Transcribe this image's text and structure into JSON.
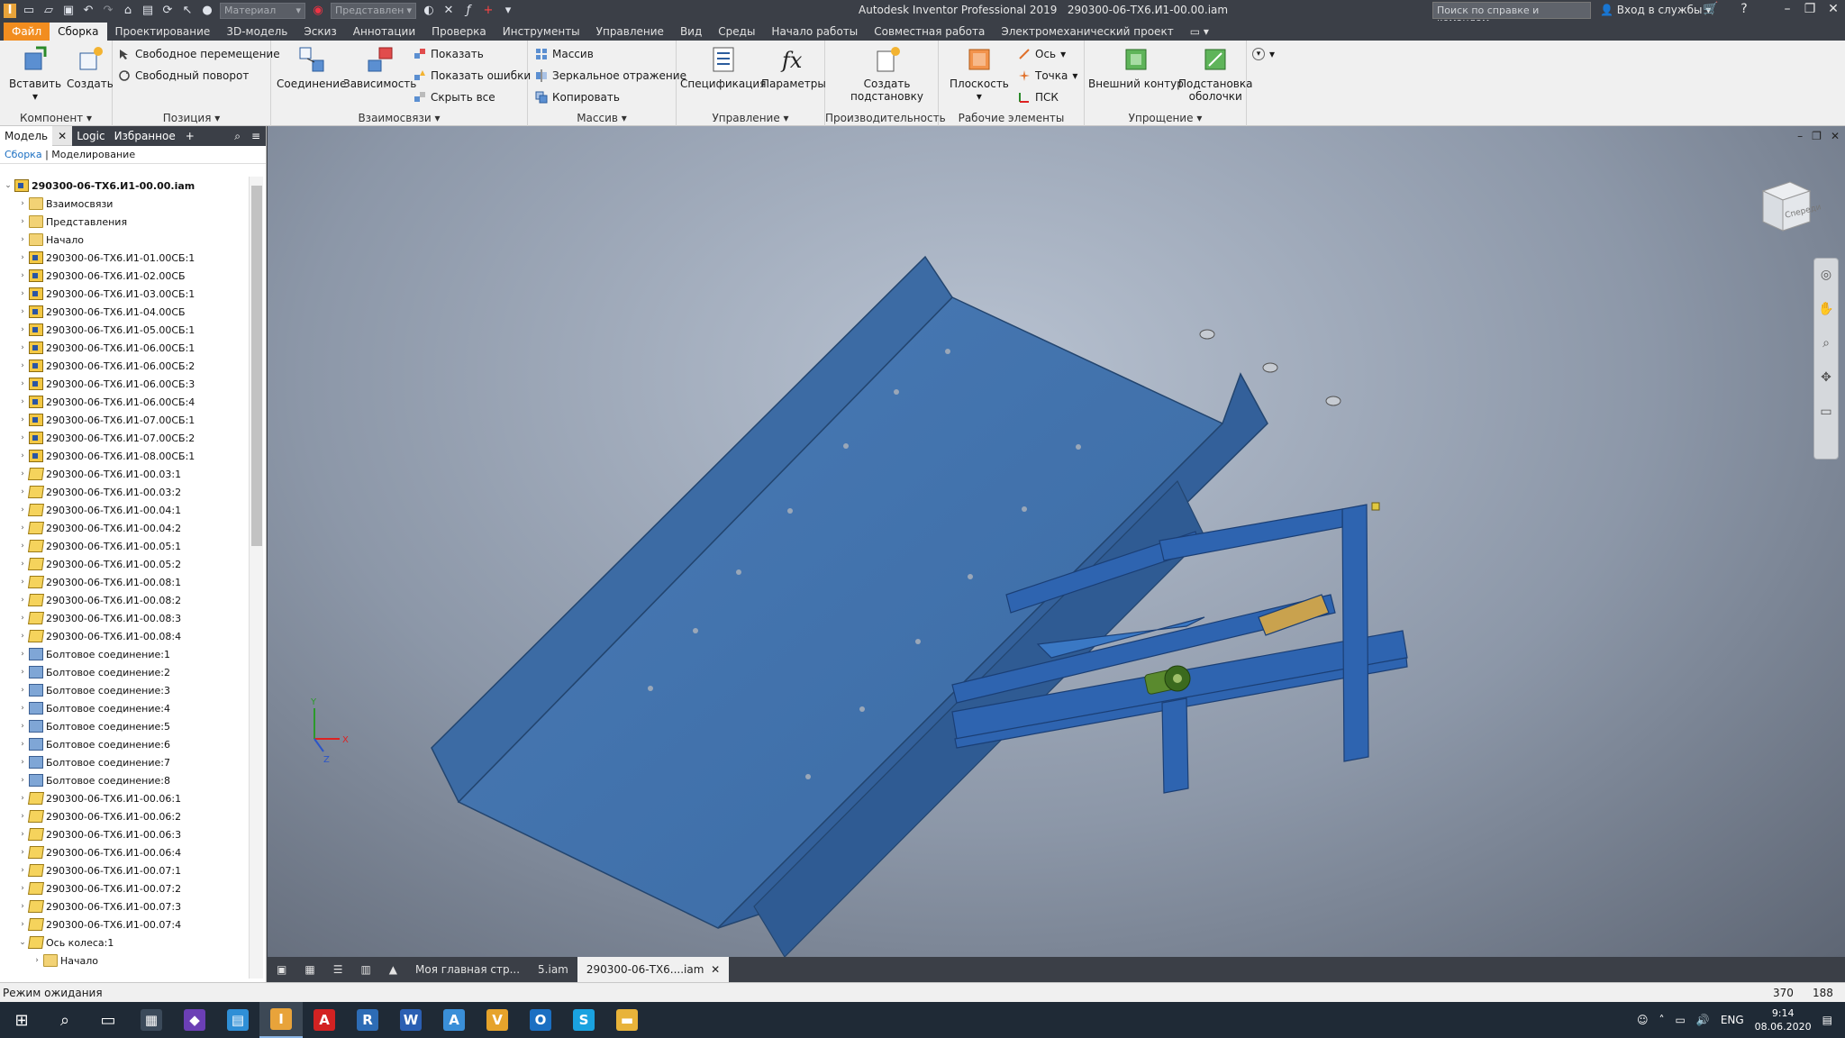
{
  "window": {
    "app_title": "Autodesk Inventor Professional 2019",
    "doc_title": "290300-06-ТХ6.И1-00.00.iam",
    "help_search_placeholder": "Поиск по справке и командам",
    "login_label": "Вход в службы",
    "material_dropdown": "Материал",
    "appearance_dropdown": "Представлен"
  },
  "ribbon_tabs": [
    "Файл",
    "Сборка",
    "Проектирование",
    "3D-модель",
    "Эскиз",
    "Аннотации",
    "Проверка",
    "Инструменты",
    "Управление",
    "Вид",
    "Среды",
    "Начало работы",
    "Совместная работа",
    "Электромеханический проект"
  ],
  "ribbon": {
    "component": {
      "title": "Компонент",
      "insert": "Вставить",
      "create": "Создать"
    },
    "position": {
      "title": "Позиция",
      "free_move": "Свободное перемещение",
      "free_rotate": "Свободный поворот"
    },
    "relationships": {
      "title": "Взаимосвязи",
      "joint": "Соединение",
      "constrain": "Зависимость",
      "show": "Показать",
      "show_errors": "Показать ошибки",
      "hide_all": "Скрыть все"
    },
    "pattern": {
      "title": "Массив",
      "pattern": "Массив",
      "mirror": "Зеркальное отражение",
      "copy": "Копировать"
    },
    "manage": {
      "title": "Управление",
      "bom": "Спецификация",
      "params": "Параметры"
    },
    "productivity": {
      "title": "Производительность",
      "substitute_line1": "Создать",
      "substitute_line2": "подстановку"
    },
    "work_features": {
      "title": "Рабочие элементы",
      "plane": "Плоскость",
      "axis": "Ось",
      "point": "Точка",
      "ucs": "ПСК"
    },
    "simplify": {
      "title": "Упрощение",
      "shrinkwrap": "Внешний контур",
      "substitute_line1": "Подстановка",
      "substitute_line2": "оболочки"
    }
  },
  "browser": {
    "tabs": [
      "Модель",
      "Logic",
      "Избранное"
    ],
    "crumb_root": "Сборка",
    "crumb_current": "Моделирование",
    "tree": [
      {
        "label": "290300-06-ТХ6.И1-00.00.iam",
        "icon": "asm",
        "level": 0,
        "expanded": true,
        "bold": true
      },
      {
        "label": "Взаимосвязи",
        "icon": "folder",
        "level": 1
      },
      {
        "label": "Представления",
        "icon": "folder",
        "level": 1
      },
      {
        "label": "Начало",
        "icon": "folder",
        "level": 1
      },
      {
        "label": "290300-06-ТХ6.И1-01.00СБ:1",
        "icon": "asm",
        "level": 1
      },
      {
        "label": "290300-06-ТХ6.И1-02.00СБ",
        "icon": "asm",
        "level": 1
      },
      {
        "label": "290300-06-ТХ6.И1-03.00СБ:1",
        "icon": "asm",
        "level": 1
      },
      {
        "label": "290300-06-ТХ6.И1-04.00СБ",
        "icon": "asm",
        "level": 1
      },
      {
        "label": "290300-06-ТХ6.И1-05.00СБ:1",
        "icon": "asm",
        "level": 1
      },
      {
        "label": "290300-06-ТХ6.И1-06.00СБ:1",
        "icon": "asm",
        "level": 1
      },
      {
        "label": "290300-06-ТХ6.И1-06.00СБ:2",
        "icon": "asm",
        "level": 1
      },
      {
        "label": "290300-06-ТХ6.И1-06.00СБ:3",
        "icon": "asm",
        "level": 1
      },
      {
        "label": "290300-06-ТХ6.И1-06.00СБ:4",
        "icon": "asm",
        "level": 1
      },
      {
        "label": "290300-06-ТХ6.И1-07.00СБ:1",
        "icon": "asm",
        "level": 1
      },
      {
        "label": "290300-06-ТХ6.И1-07.00СБ:2",
        "icon": "asm",
        "level": 1
      },
      {
        "label": "290300-06-ТХ6.И1-08.00СБ:1",
        "icon": "asm",
        "level": 1
      },
      {
        "label": "290300-06-ТХ6.И1-00.03:1",
        "icon": "part",
        "level": 1
      },
      {
        "label": "290300-06-ТХ6.И1-00.03:2",
        "icon": "part",
        "level": 1
      },
      {
        "label": "290300-06-ТХ6.И1-00.04:1",
        "icon": "part",
        "level": 1
      },
      {
        "label": "290300-06-ТХ6.И1-00.04:2",
        "icon": "part",
        "level": 1
      },
      {
        "label": "290300-06-ТХ6.И1-00.05:1",
        "icon": "part",
        "level": 1
      },
      {
        "label": "290300-06-ТХ6.И1-00.05:2",
        "icon": "part",
        "level": 1
      },
      {
        "label": "290300-06-ТХ6.И1-00.08:1",
        "icon": "part",
        "level": 1
      },
      {
        "label": "290300-06-ТХ6.И1-00.08:2",
        "icon": "part",
        "level": 1
      },
      {
        "label": "290300-06-ТХ6.И1-00.08:3",
        "icon": "part",
        "level": 1
      },
      {
        "label": "290300-06-ТХ6.И1-00.08:4",
        "icon": "part",
        "level": 1
      },
      {
        "label": "Болтовое соединение:1",
        "icon": "bolt",
        "level": 1
      },
      {
        "label": "Болтовое соединение:2",
        "icon": "bolt",
        "level": 1
      },
      {
        "label": "Болтовое соединение:3",
        "icon": "bolt",
        "level": 1
      },
      {
        "label": "Болтовое соединение:4",
        "icon": "bolt",
        "level": 1
      },
      {
        "label": "Болтовое соединение:5",
        "icon": "bolt",
        "level": 1
      },
      {
        "label": "Болтовое соединение:6",
        "icon": "bolt",
        "level": 1
      },
      {
        "label": "Болтовое соединение:7",
        "icon": "bolt",
        "level": 1
      },
      {
        "label": "Болтовое соединение:8",
        "icon": "bolt",
        "level": 1
      },
      {
        "label": "290300-06-ТХ6.И1-00.06:1",
        "icon": "part",
        "level": 1
      },
      {
        "label": "290300-06-ТХ6.И1-00.06:2",
        "icon": "part",
        "level": 1
      },
      {
        "label": "290300-06-ТХ6.И1-00.06:3",
        "icon": "part",
        "level": 1
      },
      {
        "label": "290300-06-ТХ6.И1-00.06:4",
        "icon": "part",
        "level": 1
      },
      {
        "label": "290300-06-ТХ6.И1-00.07:1",
        "icon": "part",
        "level": 1
      },
      {
        "label": "290300-06-ТХ6.И1-00.07:2",
        "icon": "part",
        "level": 1
      },
      {
        "label": "290300-06-ТХ6.И1-00.07:3",
        "icon": "part",
        "level": 1
      },
      {
        "label": "290300-06-ТХ6.И1-00.07:4",
        "icon": "part",
        "level": 1
      },
      {
        "label": "Ось колеса:1",
        "icon": "part",
        "level": 1,
        "expanded": true
      },
      {
        "label": "Начало",
        "icon": "folder",
        "level": 2
      }
    ]
  },
  "viewport": {
    "viewcube_label": "Спереди",
    "model_color": "#3f6fa8",
    "frame_color": "#2e64b0"
  },
  "doc_tabs": [
    "Моя главная стр...",
    "5.iam",
    "290300-06-ТХ6....iam"
  ],
  "status": {
    "text": "Режим ожидания",
    "x": "370",
    "y": "188"
  },
  "taskbar": {
    "lang": "ENG",
    "time": "9:14",
    "date": "08.06.2020",
    "apps": [
      {
        "name": "calculator",
        "glyph": "▦",
        "color": "#3b4a5a"
      },
      {
        "name": "visual-studio",
        "glyph": "◆",
        "color": "#6b3fb5"
      },
      {
        "name": "file-manager",
        "glyph": "▤",
        "color": "#2f8fd6"
      },
      {
        "name": "inventor",
        "glyph": "I",
        "color": "#e8a33a"
      },
      {
        "name": "acrobat",
        "glyph": "A",
        "color": "#d32222"
      },
      {
        "name": "revit",
        "glyph": "R",
        "color": "#2d6cb5"
      },
      {
        "name": "word",
        "glyph": "W",
        "color": "#2b5fb3"
      },
      {
        "name": "autocad",
        "glyph": "A",
        "color": "#3a8fd8"
      },
      {
        "name": "vault",
        "glyph": "V",
        "color": "#e6a32b"
      },
      {
        "name": "outlook",
        "glyph": "O",
        "color": "#1b6fc2"
      },
      {
        "name": "skype",
        "glyph": "S",
        "color": "#1aa2e0"
      },
      {
        "name": "explorer",
        "glyph": "▬",
        "color": "#e8b33a"
      }
    ]
  }
}
